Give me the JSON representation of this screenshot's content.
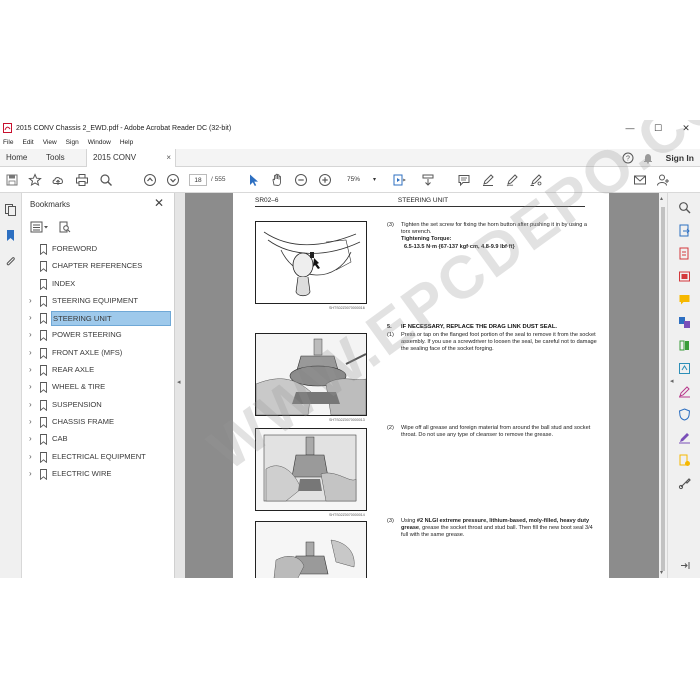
{
  "window": {
    "title": "2015 CONV Chassis 2_EWD.pdf - Adobe Acrobat Reader DC (32-bit)",
    "controls": {
      "minimize": "—",
      "maximize": "☐",
      "close": "✕"
    }
  },
  "menu": [
    "File",
    "Edit",
    "View",
    "Sign",
    "Window",
    "Help"
  ],
  "tabs": {
    "home": "Home",
    "tools": "Tools",
    "doc": "2015 CONV Chassi...",
    "doc_close": "×",
    "sign_in": "Sign In"
  },
  "toolbar": {
    "page_current": "18",
    "page_total": "/ 555",
    "zoom": "75%",
    "zoom_dropdown": "▾"
  },
  "bookmarks": {
    "header": "Bookmarks",
    "close": "✕",
    "items": [
      {
        "label": "FOREWORD",
        "expandable": false,
        "selected": false
      },
      {
        "label": "CHAPTER REFERENCES",
        "expandable": false,
        "selected": false
      },
      {
        "label": "INDEX",
        "expandable": false,
        "selected": false
      },
      {
        "label": "STEERING EQUIPMENT",
        "expandable": true,
        "selected": false
      },
      {
        "label": "STEERING UNIT",
        "expandable": true,
        "selected": true
      },
      {
        "label": "POWER STEERING",
        "expandable": true,
        "selected": false
      },
      {
        "label": "FRONT AXLE (MFS)",
        "expandable": true,
        "selected": false
      },
      {
        "label": "REAR AXLE",
        "expandable": true,
        "selected": false
      },
      {
        "label": "WHEEL & TIRE",
        "expandable": true,
        "selected": false
      },
      {
        "label": "SUSPENSION",
        "expandable": true,
        "selected": false
      },
      {
        "label": "CHASSIS FRAME",
        "expandable": true,
        "selected": false
      },
      {
        "label": "CAB",
        "expandable": true,
        "selected": false
      },
      {
        "label": "ELECTRICAL EQUIPMENT",
        "expandable": true,
        "selected": false
      },
      {
        "label": "ELECTRIC WIRE",
        "expandable": true,
        "selected": false
      }
    ]
  },
  "page": {
    "header_left": "SR02–6",
    "header_center": "STEERING UNIT",
    "fig_codes": [
      "SHTS02Z0070000016",
      "SHTS02Z0070000013",
      "SHTS02Z0070000014"
    ],
    "step3a": {
      "num": "(3)",
      "text": "Tighten the set screw for fixing the horn button after pushing it in by using a torx wrench.",
      "torque_label": "Tightening Torque:",
      "torque_value": "6.5-13.5 N·m {67-137 kgf·cm, 4.8-9.9 lbf·ft}"
    },
    "section5": {
      "num": "5.",
      "title": "IF NECESSARY, REPLACE THE DRAG LINK DUST SEAL."
    },
    "step1": {
      "num": "(1)",
      "text": "Press or tap on the flanged foot portion of the seal to remove it from the socket assembly. If you use a screwdriver to loosen the seal, be careful not to damage the sealing face of the socket forging."
    },
    "step2": {
      "num": "(2)",
      "text": "Wipe off all grease and foreign material from around the ball stud and socket throat. Do not use any type of cleanser to remove the grease."
    },
    "step3b": {
      "num": "(3)",
      "text_prefix": "Using ",
      "text_bold": "#2 NLGI extreme pressure, lithium-based, moly-filled, heavy duty grease",
      "text_suffix": ", grease the socket throat and stud ball. Then fill the new boot seal 3/4 full with the same grease."
    }
  },
  "watermark": "WWW.EPCDEPO.COM"
}
